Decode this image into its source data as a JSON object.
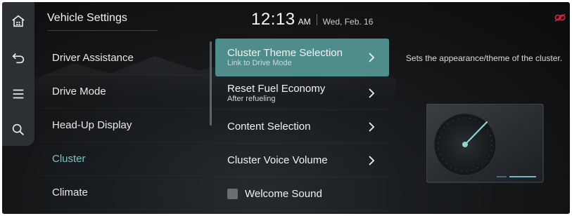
{
  "header": {
    "title": "Vehicle Settings",
    "time": "12:13",
    "ampm": "AM",
    "date": "Wed, Feb. 16"
  },
  "rail": {
    "icons": [
      "home-icon",
      "back-icon",
      "menu-icon",
      "search-icon"
    ]
  },
  "categories": [
    {
      "label": "Driver Assistance",
      "active": false
    },
    {
      "label": "Drive Mode",
      "active": false
    },
    {
      "label": "Head-Up Display",
      "active": false
    },
    {
      "label": "Cluster",
      "active": true
    },
    {
      "label": "Climate",
      "active": false
    }
  ],
  "settings": [
    {
      "label": "Cluster Theme Selection",
      "sub": "Link to Drive Mode",
      "selected": true
    },
    {
      "label": "Reset Fuel Economy",
      "sub": "After refueling",
      "selected": false
    },
    {
      "label": "Content Selection",
      "sub": "",
      "selected": false
    },
    {
      "label": "Cluster Voice Volume",
      "sub": "",
      "selected": false
    },
    {
      "label": "Welcome Sound",
      "checkbox": true,
      "checked": false
    }
  ],
  "description": "Sets the appearance/theme of the cluster.",
  "colors": {
    "accent": "#4f8d8c",
    "active_text": "#7fc3c2",
    "status_icon": "#d6253a"
  }
}
